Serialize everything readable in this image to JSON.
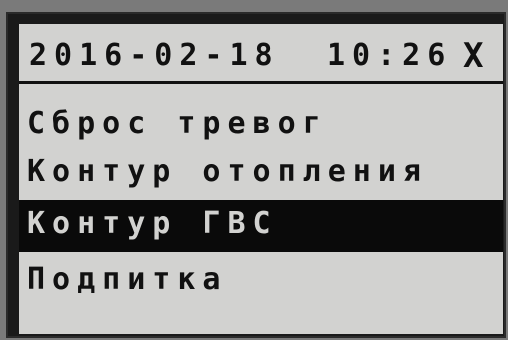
{
  "header": {
    "date": "2016-02-18",
    "time": "10:26",
    "status_icon": "X"
  },
  "menu": {
    "items": [
      {
        "label": "Сброс тревог",
        "selected": false
      },
      {
        "label": "Контур отопления",
        "selected": false
      },
      {
        "label": "Контур ГВС",
        "selected": true
      },
      {
        "label": "Подпитка",
        "selected": false
      }
    ]
  },
  "colors": {
    "lcd_background": "#d2d2d0",
    "text": "#111111",
    "highlight": "#0a0a0a"
  }
}
